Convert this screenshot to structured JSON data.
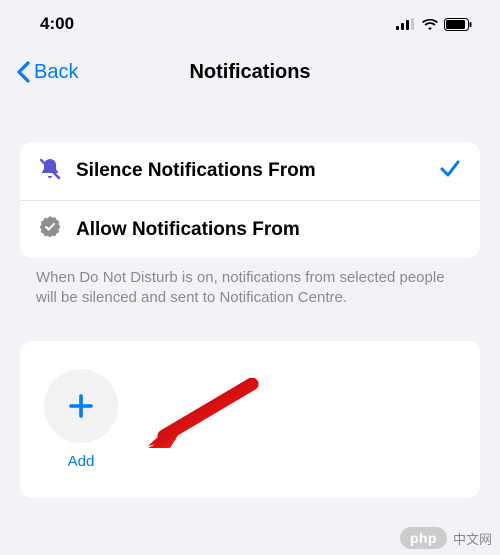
{
  "status": {
    "time": "4:00"
  },
  "nav": {
    "back": "Back",
    "title": "Notifications"
  },
  "options": {
    "silence": {
      "label": "Silence Notifications From",
      "selected": true
    },
    "allow": {
      "label": "Allow Notifications From",
      "selected": false
    }
  },
  "footer": "When Do Not Disturb is on, notifications from selected people will be silenced and sent to Notification Centre.",
  "add": {
    "label": "Add"
  },
  "watermark": {
    "badge": "php",
    "text": "中文网"
  }
}
